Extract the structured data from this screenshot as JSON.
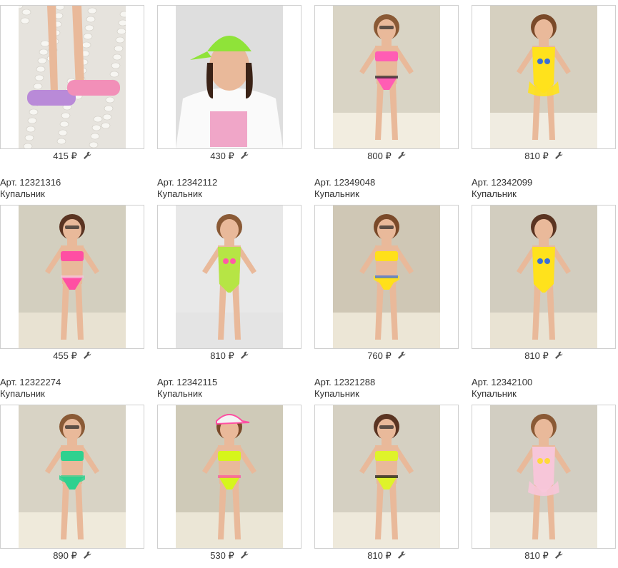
{
  "currency": "₽",
  "colors": {
    "border": "#cfcfcf",
    "text": "#333333"
  },
  "products": [
    {
      "price": "415 ₽",
      "sku": "Арт. 12321316",
      "category": "Купальник",
      "scene": "sandals-on-pebbles",
      "main_color": "#b98ad8",
      "accent_color": "#f28fb8"
    },
    {
      "price": "430 ₽",
      "sku": "Арт. 12342112",
      "category": "Купальник",
      "scene": "girl-green-cap-white-sweatshirt",
      "main_color": "#8fe339",
      "accent_color": "#f0a6c8"
    },
    {
      "price": "800 ₽",
      "sku": "Арт. 12349048",
      "category": "Купальник",
      "scene": "pink-bikini",
      "main_color": "#ff5db4",
      "accent_color": "#222222"
    },
    {
      "price": "810 ₽",
      "sku": "Арт. 12342099",
      "category": "Купальник",
      "scene": "yellow-swimsuit-ruffle",
      "main_color": "#ffe21c",
      "accent_color": "#3b6fd6"
    },
    {
      "price": "455 ₽",
      "sku": "Арт. 12322274",
      "category": "Купальник",
      "scene": "flamingo-print-bikini",
      "main_color": "#ff4fa3",
      "accent_color": "#f7c8de"
    },
    {
      "price": "810 ₽",
      "sku": "Арт. 12342115",
      "category": "Купальник",
      "scene": "green-swimsuit-tom-and-jerry",
      "main_color": "#b6e545",
      "accent_color": "#ff5aa7"
    },
    {
      "price": "760 ₽",
      "sku": "Арт. 12321288",
      "category": "Купальник",
      "scene": "yellow-bikini-ruffle",
      "main_color": "#ffe01a",
      "accent_color": "#3b6fd6"
    },
    {
      "price": "810 ₽",
      "sku": "Арт. 12342100",
      "category": "Купальник",
      "scene": "yellow-swimsuit-tweety",
      "main_color": "#ffe21c",
      "accent_color": "#3b6fd6"
    },
    {
      "price": "890 ₽",
      "sku": "",
      "category": "",
      "scene": "green-ruffle-bikini",
      "main_color": "#2fd18f",
      "accent_color": "#2fd18f"
    },
    {
      "price": "530 ₽",
      "sku": "",
      "category": "",
      "scene": "neon-bikini-cap",
      "main_color": "#d6f51b",
      "accent_color": "#ff4fa3"
    },
    {
      "price": "810 ₽",
      "sku": "",
      "category": "",
      "scene": "neon-sport-bikini",
      "main_color": "#dff32a",
      "accent_color": "#111111"
    },
    {
      "price": "810 ₽",
      "sku": "",
      "category": "",
      "scene": "pink-tweety-swimsuit",
      "main_color": "#f7c6d9",
      "accent_color": "#ffd93b"
    }
  ]
}
